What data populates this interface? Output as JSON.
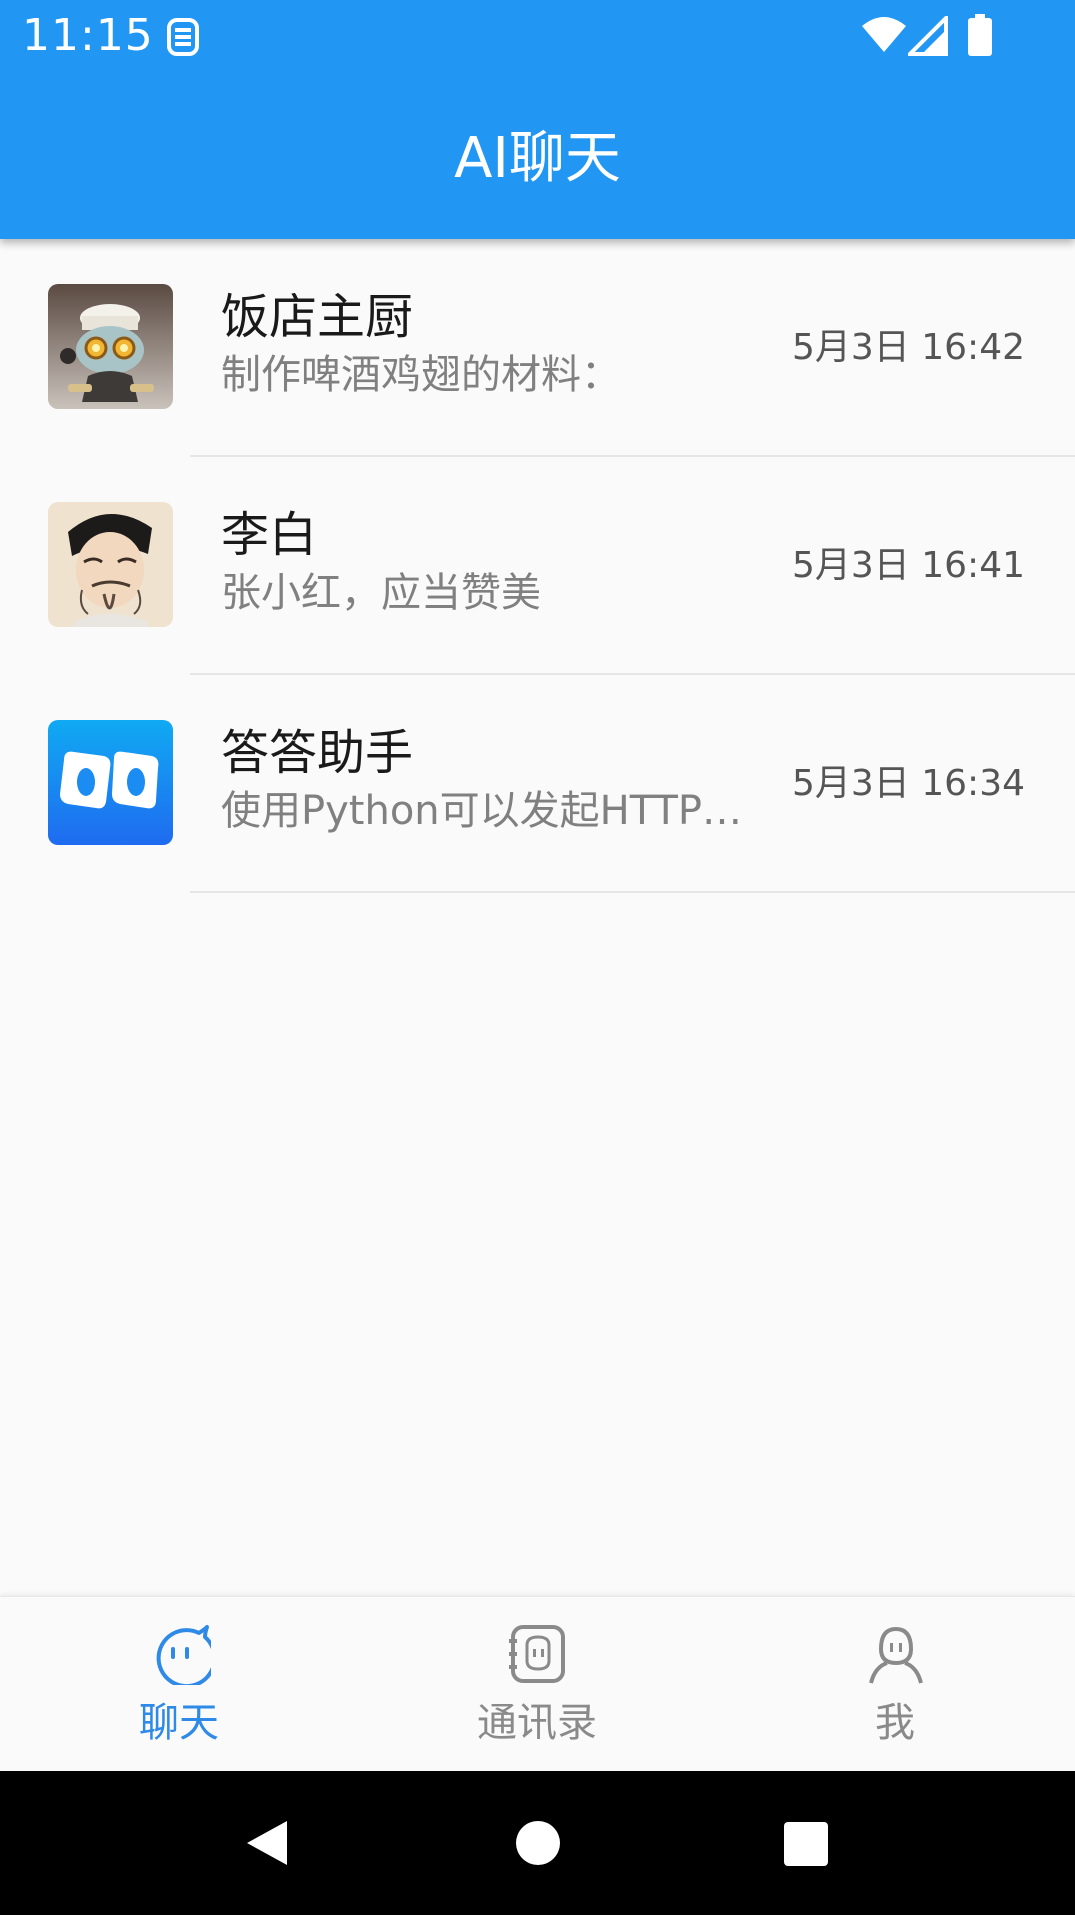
{
  "status_bar": {
    "time": "11:15",
    "icons": [
      "sim-icon",
      "wifi-icon",
      "signal-icon",
      "battery-icon"
    ]
  },
  "app_bar": {
    "title": "AI聊天",
    "color": "#2196f3"
  },
  "chats": [
    {
      "name": "饭店主厨",
      "preview": "制作啤酒鸡翅的材料：",
      "time": "5月3日 16:42",
      "avatar": "chef-avatar"
    },
    {
      "name": "李白",
      "preview": "张小红，应当赞美",
      "time": "5月3日 16:41",
      "avatar": "li-bai-avatar"
    },
    {
      "name": "答答助手",
      "preview": "使用Python可以发起HTTP…",
      "time": "5月3日 16:34",
      "avatar": "dada-assistant-avatar"
    }
  ],
  "bottom_nav": {
    "tabs": [
      {
        "label": "聊天",
        "icon": "chat-bubble-icon",
        "active": true
      },
      {
        "label": "通讯录",
        "icon": "contacts-icon",
        "active": false
      },
      {
        "label": "我",
        "icon": "person-icon",
        "active": false
      }
    ],
    "active_color": "#2e8ae6",
    "inactive_color": "#8a8a8a"
  },
  "system_nav": {
    "icons": [
      "back-icon",
      "home-icon",
      "recents-icon"
    ]
  }
}
